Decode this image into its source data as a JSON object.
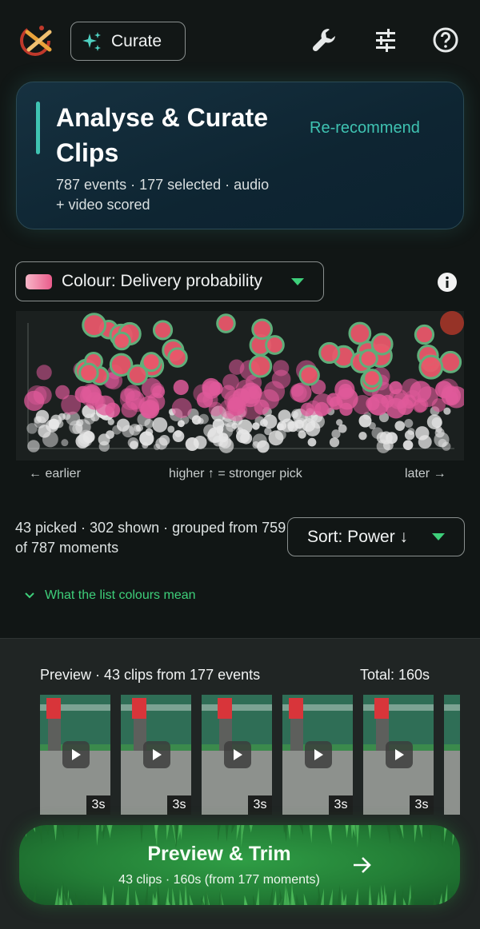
{
  "topbar": {
    "curate_label": "Curate",
    "icons": [
      "logo-icon",
      "sparkle-icon",
      "wrench-icon",
      "sliders-icon",
      "help-icon"
    ]
  },
  "hero": {
    "title": "Analyse & Curate Clips",
    "subtitle": "787 events · 177 selected · audio + video scored",
    "action_label": "Re-recommend",
    "accent": "#3fc3b2"
  },
  "colour_dropdown": {
    "label": "Colour: Delivery probability",
    "icon": "info-icon"
  },
  "scatter": {
    "left_label": "← earlier",
    "center_label": "higher ↑ = stronger pick",
    "right_label": "later →",
    "colors": {
      "picked": "#e8576a",
      "picked_ring": "#5fae7a",
      "pink": "#e05a9a",
      "white": "#e6e6e6"
    }
  },
  "summary": {
    "counts_text": "43 picked · 302 shown · grouped from 759 of 787 moments",
    "sort_label": "Sort: Power ↓"
  },
  "legend_link": {
    "label": "What the list colours mean"
  },
  "preview": {
    "title": "Preview · 43 clips from 177 events",
    "total": "Total: 160s",
    "clips": [
      {
        "duration": "3s"
      },
      {
        "duration": "3s"
      },
      {
        "duration": "3s"
      },
      {
        "duration": "3s"
      },
      {
        "duration": "3s"
      },
      {
        "duration": ""
      }
    ]
  },
  "cta": {
    "title": "Preview & Trim",
    "subtitle": "43 clips · 160s (from 177 moments)",
    "accent": "#2f9d45"
  }
}
